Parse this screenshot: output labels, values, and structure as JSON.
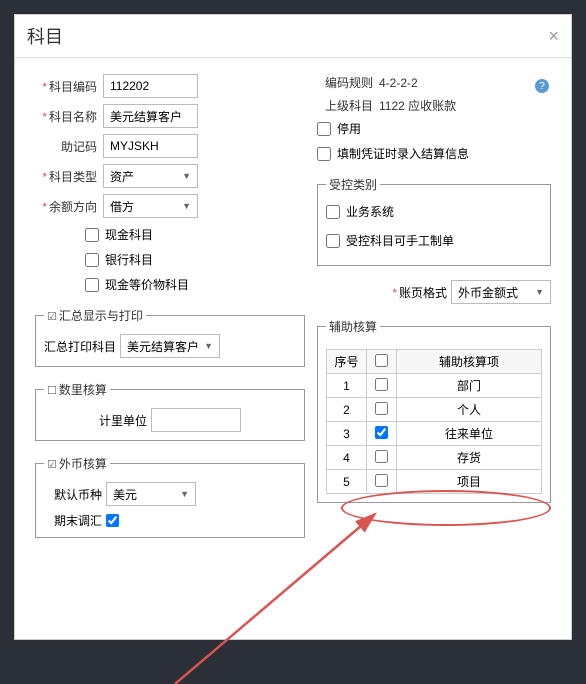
{
  "dialog": {
    "title": "科目"
  },
  "form": {
    "code_label": "科目编码",
    "code_value": "112202",
    "name_label": "科目名称",
    "name_value": "美元结算客户",
    "mnemonic_label": "助记码",
    "mnemonic_value": "MYJSKH",
    "type_label": "科目类型",
    "type_value": "资产",
    "balance_dir_label": "余额方向",
    "balance_dir_value": "借方"
  },
  "chk_section": {
    "cash": "现金科目",
    "bank": "银行科目",
    "equiv": "现金等价物科目"
  },
  "fs_summary": {
    "legend": "汇总显示与打印",
    "print_label": "汇总打印科目",
    "print_value": "美元结算客户"
  },
  "fs_qty": {
    "legend": "数里核算",
    "unit_label": "计里单位"
  },
  "fs_fx": {
    "legend": "外币核算",
    "ccy_label": "默认币种",
    "ccy_value": "美元",
    "adjust_label": "期末调汇"
  },
  "right": {
    "rule_label": "编码规则",
    "rule_value": "4-2-2-2",
    "parent_label": "上级科目",
    "parent_value": "1122 应收账款",
    "disable": "停用",
    "voucher": "填制凭证时录入结算信息"
  },
  "fs_ctrl": {
    "legend": "受控类别",
    "biz": "业务系统",
    "manual": "受控科目可手工制单"
  },
  "acct_fmt": {
    "label": "账页格式",
    "value": "外币金额式"
  },
  "fs_aux": {
    "legend": "辅助核算",
    "headers": {
      "seq": "序号",
      "chk": "",
      "item": "辅助核算项"
    },
    "rows": [
      {
        "seq": "1",
        "checked": false,
        "item": "部门"
      },
      {
        "seq": "2",
        "checked": false,
        "item": "个人"
      },
      {
        "seq": "3",
        "checked": true,
        "item": "往来单位"
      },
      {
        "seq": "4",
        "checked": false,
        "item": "存货"
      },
      {
        "seq": "5",
        "checked": false,
        "item": "项目"
      }
    ]
  }
}
